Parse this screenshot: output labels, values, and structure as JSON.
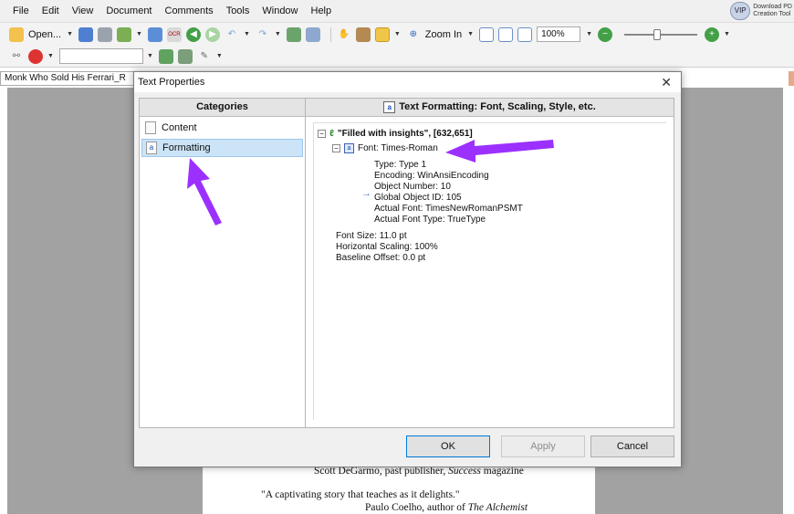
{
  "menu": [
    "File",
    "Edit",
    "View",
    "Document",
    "Comments",
    "Tools",
    "Window",
    "Help"
  ],
  "promo": {
    "badge": "VIP",
    "line1": "Download PD",
    "line2": "Creation Tool"
  },
  "toolbar": {
    "open_label": "Open...",
    "zoom_in_label": "Zoom In",
    "zoom_value": "100%"
  },
  "document": {
    "tab_title": "Monk Who Sold His Ferrari_R",
    "line1": "Scott DeGarmo, past publisher, ",
    "line1_italic": "Success",
    "line1_end": " magazine",
    "line2": "\"A captivating story that teaches as it delights.\"",
    "line3": "Paulo Coelho, author of ",
    "line3_italic": "The Alchemist"
  },
  "dialog": {
    "title": "Text Properties",
    "close_label": "✕",
    "categories_header": "Categories",
    "categories": [
      {
        "label": "Content",
        "selected": false
      },
      {
        "label": "Formatting",
        "selected": true
      }
    ],
    "details_header": "Text Formatting: Font, Scaling, Style, etc.",
    "tree": {
      "root": "\"Filled with insights\", [632,651]",
      "font_node": "Font: Times-Roman",
      "font_props": [
        "Type: Type 1",
        "Encoding: WinAnsiEncoding",
        "Object Number: 10",
        "Global Object ID: 105",
        "Actual Font: TimesNewRomanPSMT",
        "Actual Font Type: TrueType"
      ],
      "metrics": [
        "Font Size: 11.0 pt",
        "Horizontal Scaling: 100%",
        "Baseline Offset: 0.0 pt"
      ]
    },
    "buttons": {
      "ok": "OK",
      "apply": "Apply",
      "cancel": "Cancel"
    }
  },
  "annotation_color": "#9b30ff"
}
